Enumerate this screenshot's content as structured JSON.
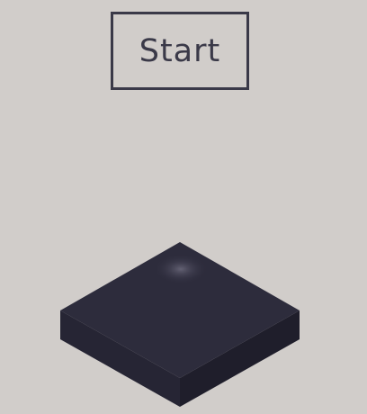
{
  "start_button": {
    "label": "Start"
  },
  "colors": {
    "background": "#d1cdca",
    "button_ink": "#3a3948",
    "tile_top": "#2d2c3c",
    "tile_left": "#262534",
    "tile_right": "#1f1e2b",
    "tile_glow": "#5a5868"
  },
  "scene": {
    "block_shape": "isometric-square-slab"
  }
}
